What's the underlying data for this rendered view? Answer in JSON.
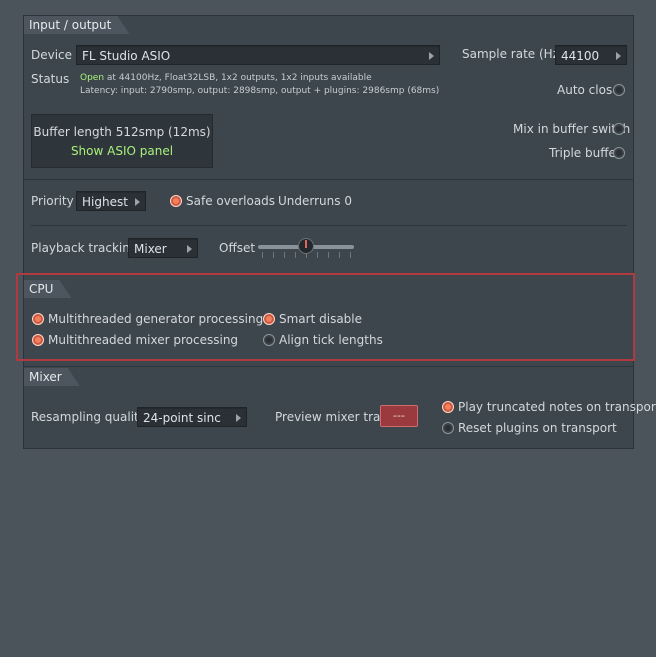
{
  "input_output": {
    "tab": "Input / output",
    "device_label": "Device",
    "device_value": "FL Studio ASIO",
    "sample_rate_label": "Sample rate (Hz)",
    "sample_rate_value": "44100",
    "status_label": "Status",
    "status_open": "Open",
    "status_line1_rest": " at 44100Hz, Float32LSB, 1x2 outputs, 1x2 inputs available",
    "status_line2": "Latency: input: 2790smp, output: 2898smp, output + plugins: 2986smp (68ms)",
    "auto_close": "Auto close",
    "buffer_length": "Buffer length 512smp (12ms)",
    "show_asio_panel": "Show ASIO panel",
    "mix_in_buffer_switch": "Mix in buffer switch",
    "triple_buffer": "Triple buffer",
    "priority_label": "Priority",
    "priority_value": "Highest",
    "safe_overloads": "Safe overloads",
    "underruns": "Underruns 0",
    "playback_tracking_label": "Playback tracking",
    "playback_tracking_value": "Mixer",
    "offset_label": "Offset"
  },
  "cpu": {
    "tab": "CPU",
    "multithreaded_generator": "Multithreaded generator processing",
    "multithreaded_mixer": "Multithreaded mixer processing",
    "smart_disable": "Smart disable",
    "align_tick_lengths": "Align tick lengths"
  },
  "mixer": {
    "tab": "Mixer",
    "resampling_label": "Resampling quality",
    "resampling_value": "24-point sinc",
    "preview_mixer_track": "Preview mixer track",
    "preview_mixer_value": "---",
    "play_truncated": "Play truncated notes on transport",
    "reset_plugins": "Reset plugins on transport"
  },
  "colors": {
    "accent_on": "#f47f5f",
    "status_green": "#a8f07a",
    "highlight_red": "#b03a3f"
  }
}
